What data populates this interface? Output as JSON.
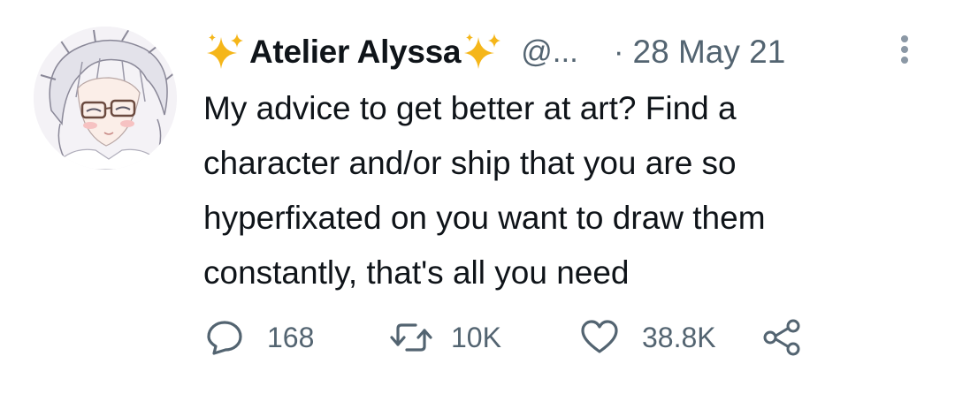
{
  "tweet": {
    "display_name": "Atelier Alyssa",
    "handle": "@...",
    "separator": "·",
    "date": "28 May 21",
    "text": "My advice to get better at art? Find a\ncharacter and/or ship that you are so\nhyperfixated on you want to draw them\nconstantly, that's all you need",
    "name_emoji": "sparkles-icon"
  },
  "actions": {
    "reply_count": "168",
    "retweet_count": "10K",
    "like_count": "38.8K"
  },
  "colors": {
    "text_primary": "#0f1419",
    "text_secondary": "#536471",
    "sparkle": "#f5b619",
    "background": "#ffffff"
  },
  "icons": {
    "reply": "speech-bubble-icon",
    "retweet": "retweet-arrows-icon",
    "like": "heart-icon",
    "share": "share-nodes-icon",
    "more": "vertical-dots-icon"
  }
}
